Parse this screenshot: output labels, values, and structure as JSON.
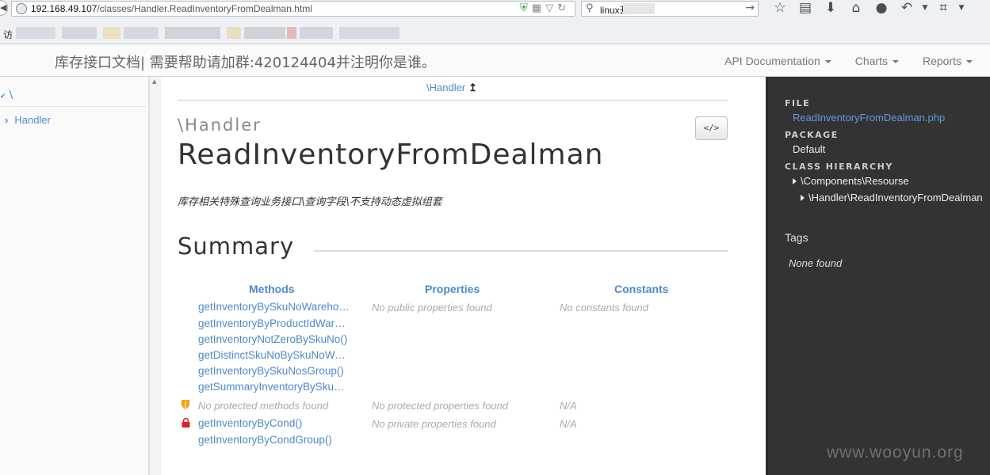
{
  "browser": {
    "url_host": "192.168.49.107",
    "url_path": "/classes/Handler.ReadInventoryFromDealman.html",
    "search_text": "linux开",
    "bookmarks_label": "访"
  },
  "navbar": {
    "brand": "库存接口文档| 需要帮助请加群:420124404并注明你是谁。",
    "menus": [
      "API Documentation",
      "Charts",
      "Reports"
    ]
  },
  "left_nav": {
    "root": "\\",
    "items": [
      "Handler"
    ]
  },
  "main": {
    "breadcrumb": "\\Handler",
    "namespace": "\\Handler",
    "class_name": "ReadInventoryFromDealman",
    "description": "库存相关特殊查询业务接口\\查询字段\\不支持动态虚拟组套",
    "source_button": "</>",
    "summary_title": "Summary",
    "columns": {
      "methods": "Methods",
      "properties": "Properties",
      "constants": "Constants"
    },
    "public_methods": [
      "getInventoryBySkuNoWarehouse()",
      "getInventoryByProductIdWarehouse()",
      "getInventoryNotZeroBySkuNo()",
      "getDistinctSkuNoBySkuNoWarehouse()",
      "getInventoryBySkuNosGroup()",
      "getSummaryInventoryBySkuNo()"
    ],
    "no_public_properties": "No public properties found",
    "no_constants": "No constants found",
    "no_protected_methods": "No protected methods found",
    "no_protected_properties": "No protected properties found",
    "protected_constants_na": "N/A",
    "private_methods": [
      "getInventoryByCond()",
      "getInventoryByCondGroup()"
    ],
    "no_private_properties": "No private properties found",
    "private_constants_na": "N/A"
  },
  "sidebar": {
    "file_label": "FILE",
    "file_name": "ReadInventoryFromDealman.php",
    "package_label": "PACKAGE",
    "package_name": "Default",
    "hierarchy_label": "CLASS HIERARCHY",
    "hierarchy": [
      "\\Components\\Resourse",
      "\\Handler\\ReadInventoryFromDealman"
    ],
    "tags_label": "Tags",
    "tags_none": "None found"
  },
  "watermark": "www.wooyun.org",
  "colors": {
    "link": "#4d8acb",
    "sidebar_bg": "#333333",
    "protected_icon": "#f0a30a",
    "private_icon": "#d9232d"
  }
}
